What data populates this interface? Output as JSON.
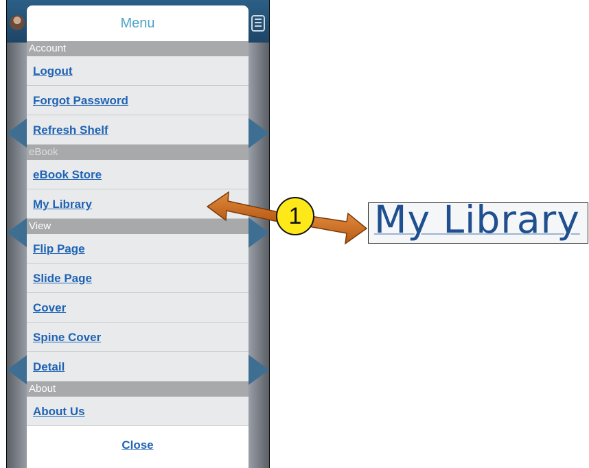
{
  "menu": {
    "title": "Menu",
    "sections": [
      {
        "label": "Account",
        "items": [
          "Logout",
          "Forgot Password",
          "Refresh Shelf"
        ]
      },
      {
        "label": "eBook",
        "items": [
          "eBook Store",
          "My Library"
        ]
      },
      {
        "label": "View",
        "items": [
          "Flip Page",
          "Slide Page",
          "Cover",
          "Spine Cover",
          "Detail"
        ]
      },
      {
        "label": "About",
        "items": [
          "About Us"
        ]
      }
    ],
    "close_label": "Close"
  },
  "callout": {
    "number": "1",
    "zoom_text": "My Library"
  },
  "colors": {
    "accent": "#4aa4c6",
    "link": "#1f63b5",
    "section_bg": "#a7a9ab",
    "arrow": "#cc6a1e",
    "badge": "#ffe819"
  },
  "icons": [
    "avatar-icon",
    "hamburger-menu-icon"
  ]
}
